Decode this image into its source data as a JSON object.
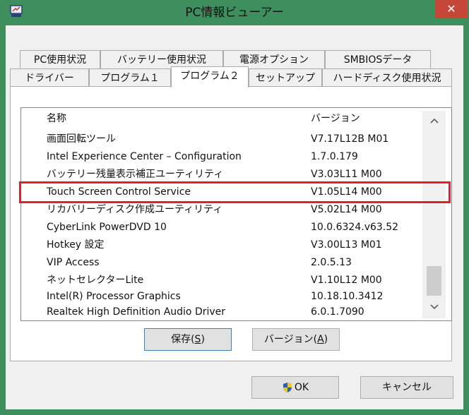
{
  "window": {
    "title": "PC情報ビューアー",
    "close_glyph": "✕"
  },
  "tabs_row1": [
    "PC使用状況",
    "バッテリー使用状況",
    "電源オプション",
    "SMBIOSデータ"
  ],
  "tabs_row2": [
    "ドライバー",
    "プログラム１",
    "プログラム２",
    "セットアップ",
    "ハードディスク使用状況"
  ],
  "active_tab": "プログラム２",
  "list": {
    "headers": {
      "name": "名称",
      "version": "バージョン"
    },
    "rows": [
      {
        "name": "画面回転ツール",
        "version": "V7.17L12B M01"
      },
      {
        "name": "Intel Experience Center – Configuration",
        "version": "1.7.0.179"
      },
      {
        "name": "バッテリー残量表示補正ユーティリティ",
        "version": "V3.03L11 M00"
      },
      {
        "name": "Touch Screen Control Service",
        "version": "V1.05L14 M00"
      },
      {
        "name": "リカバリーディスク作成ユーティリティ",
        "version": "V5.02L14 M00"
      },
      {
        "name": "CyberLink PowerDVD 10",
        "version": "10.0.6324.v63.52"
      },
      {
        "name": "Hotkey 設定",
        "version": "V3.00L13 M01"
      },
      {
        "name": "VIP Access",
        "version": "2.0.5.13"
      },
      {
        "name": "ネットセレクターLite",
        "version": "V1.10L12 M00"
      },
      {
        "name": "Intel(R) Processor Graphics",
        "version": "10.18.10.3412"
      },
      {
        "name": "Realtek High Definition Audio Driver",
        "version": "6.0.1.7090"
      }
    ],
    "highlighted_row": "Touch Screen Control Service"
  },
  "buttons": {
    "save": {
      "label": "保存(",
      "accel": "S",
      "tail": ")"
    },
    "version": {
      "label": "バージョン(",
      "accel": "A",
      "tail": ")"
    },
    "ok": "OK",
    "cancel": "キャンセル"
  },
  "colors": {
    "titlebar": "#3f8f5e",
    "close": "#c7463a",
    "highlight_border": "#e0202a",
    "shield_blue": "#2b5fb8",
    "shield_yellow": "#f2c81e"
  },
  "icons": {
    "app": "pc-info-icon",
    "scroll_up": "chevron-up-icon",
    "scroll_down": "chevron-down-icon",
    "ok": "uac-shield-icon"
  }
}
